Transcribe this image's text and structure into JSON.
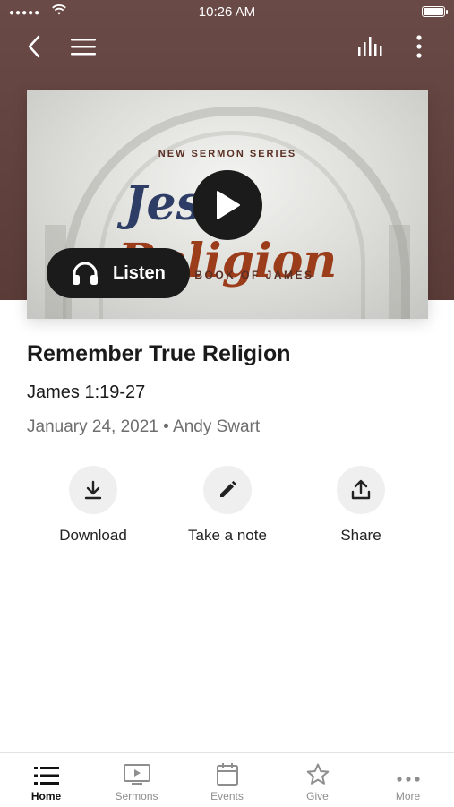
{
  "status_bar": {
    "time": "10:26 AM"
  },
  "artwork": {
    "series_label": "NEW SERMON SERIES",
    "series_title_word1": "Jesus",
    "series_title_word2": "Religion",
    "series_subtitle": "THE BOOK OF JAMES"
  },
  "listen_button": {
    "label": "Listen"
  },
  "sermon": {
    "title": "Remember True Religion",
    "reference": "James 1:19-27",
    "date": "January 24, 2021",
    "speaker": "Andy Swart"
  },
  "actions": [
    {
      "label": "Download",
      "icon": "download-icon"
    },
    {
      "label": "Take a note",
      "icon": "pencil-icon"
    },
    {
      "label": "Share",
      "icon": "share-icon"
    }
  ],
  "tabs": [
    {
      "label": "Home",
      "icon": "list-icon",
      "active": true
    },
    {
      "label": "Sermons",
      "icon": "tv-play-icon"
    },
    {
      "label": "Events",
      "icon": "calendar-icon"
    },
    {
      "label": "Give",
      "icon": "star-icon"
    },
    {
      "label": "More",
      "icon": "ellipsis-icon"
    }
  ],
  "colors": {
    "header_background": "#5a3b38",
    "button_dark": "#1b1b1b",
    "action_circle": "#efefef",
    "tab_active": "#111111",
    "tab_inactive": "#8e8e8e"
  }
}
